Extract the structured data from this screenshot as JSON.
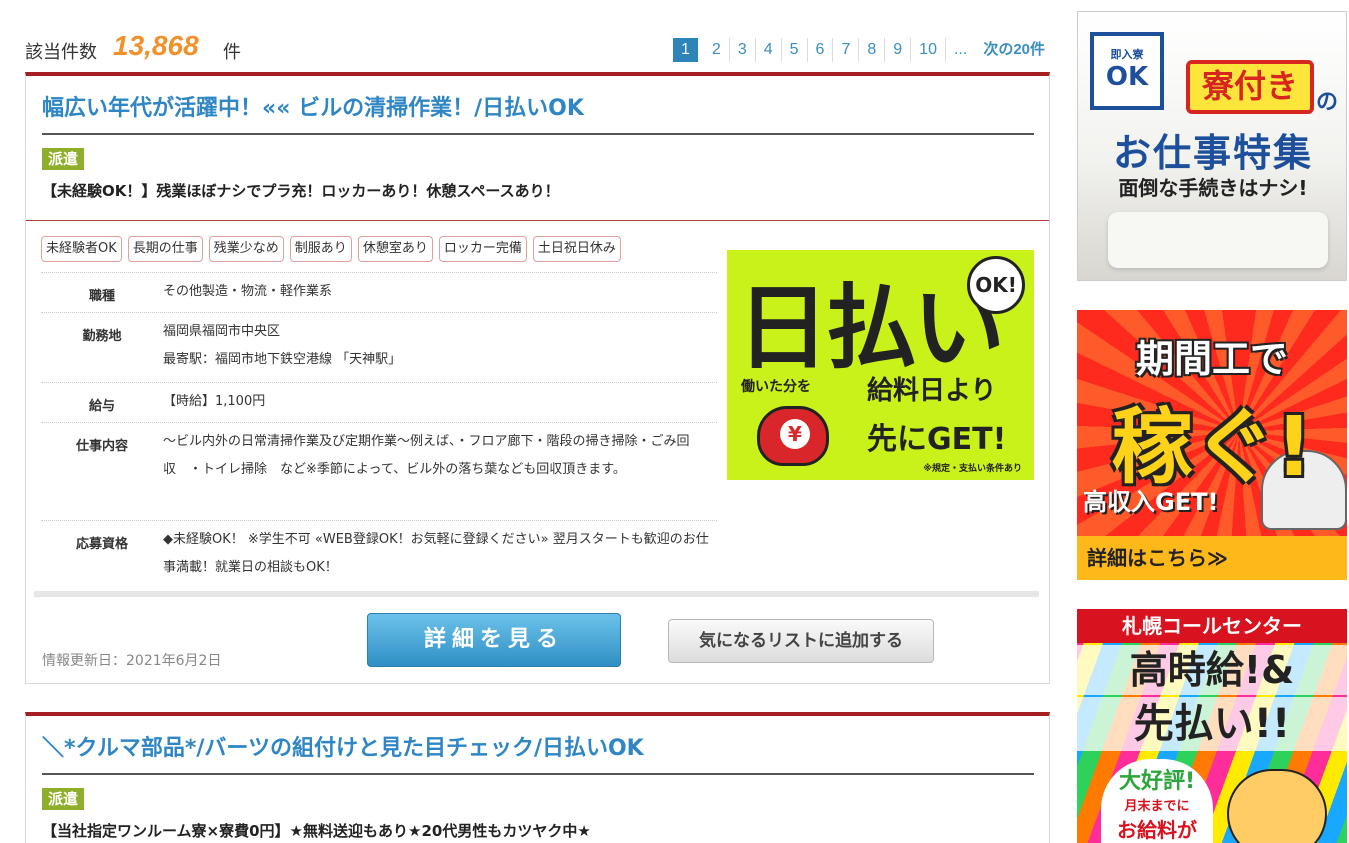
{
  "results": {
    "label": "該当件数",
    "count": "13,868",
    "unit": "件"
  },
  "pager": {
    "active": "1",
    "pages": [
      "2",
      "3",
      "4",
      "5",
      "6",
      "7",
      "8",
      "9",
      "10"
    ],
    "ellipsis": "...",
    "next": "次の20件"
  },
  "job1": {
    "title": "幅広い年代が活躍中！«« ビルの清掃作業！/日払いOK",
    "badge": "派遣",
    "subhead": "【未経験OK！】残業ほぼナシでプラ充！ロッカーあり！休憩スペースあり！",
    "tags": [
      "未経験者OK",
      "長期の仕事",
      "残業少なめ",
      "制服あり",
      "休憩室あり",
      "ロッカー完備",
      "土日祝日休み"
    ],
    "info": {
      "job_type_label": "職種",
      "job_type": "その他製造・物流・軽作業系",
      "location_label": "勤務地",
      "location": "福岡県福岡市中央区",
      "station": "最寄駅：福岡市地下鉄空港線 「天神駅」",
      "salary_label": "給与",
      "salary": "【時給】1,100円",
      "content_label": "仕事内容",
      "content": "～ビル内外の日常清掃作業及び定期作業～例えば、・フロア廊下・階段の掃き掃除・ごみ回収　・トイレ掃除　など※季節によって、ビル外の落ち葉なども回収頂きます。",
      "requirements_label": "応募資格",
      "requirements": "◆未経験OK！ ※学生不可 «WEB登録OK！お気軽に登録ください» 翌月スタートも歓迎のお仕事満載！就業日の相談もOK！"
    },
    "image": {
      "big": "日払い",
      "ok": "OK!",
      "work": "働いた分を",
      "pay": "給料日より",
      "get": "先にGET!",
      "yen": "¥",
      "note": "※規定・支払い条件あり"
    },
    "updated": "情報更新日：2021年6月2日",
    "detail_button": "詳細を見る",
    "favorite_button": "気になるリストに追加する"
  },
  "job2": {
    "title": "＼*クルマ部品*/バーツの組付けと見た目チェック/日払いOK",
    "badge": "派遣",
    "subhead": "【当社指定ワンルーム寮×寮費0円】★無料送迎もあり★20代男性もカツヤク中★"
  },
  "ads": {
    "ad1": {
      "house_small": "即入寮",
      "house_big": "OK",
      "dorm": "寮付き",
      "no": "の",
      "feature": "お仕事特集",
      "easy": "面倒な手続きはナシ!"
    },
    "ad2": {
      "line1": "期間工で",
      "line2": "稼ぐ!",
      "line3": "高収入GET!",
      "line4": "詳細はこちら≫"
    },
    "ad3": {
      "top": "札幌コールセンター",
      "hi": "高時給!&",
      "pre": "先払い!!",
      "pop_a": "大好評!",
      "pop_b": "月末までに",
      "pop_c": "お給料が"
    }
  }
}
